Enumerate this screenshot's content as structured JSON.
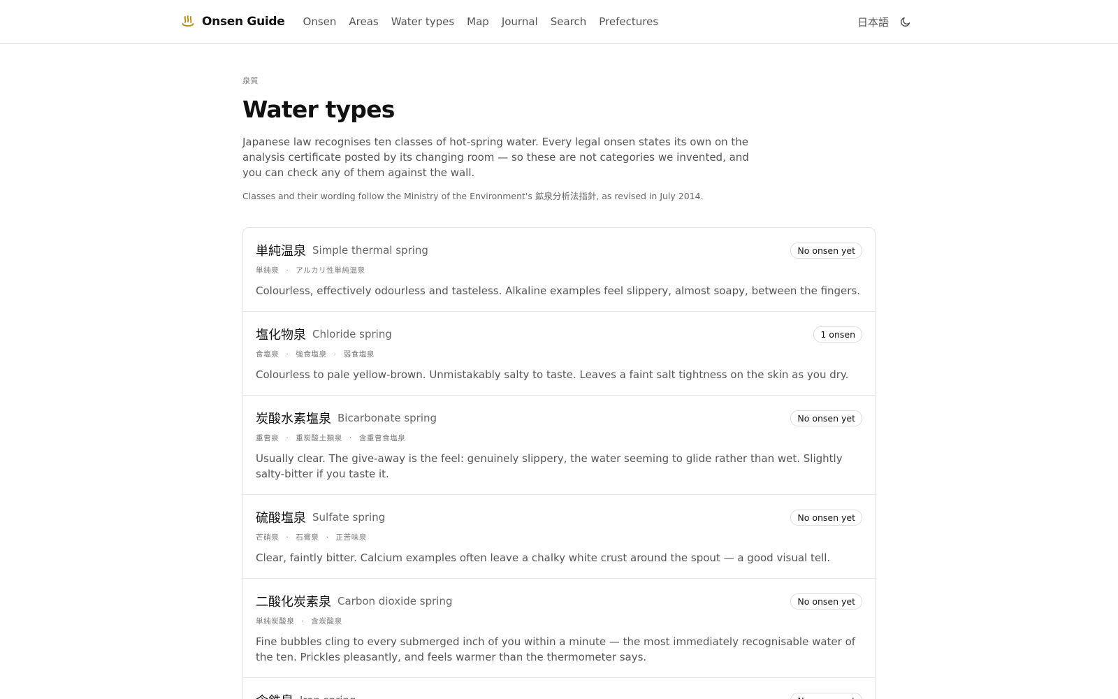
{
  "header": {
    "brand": "Onsen Guide",
    "nav": [
      "Onsen",
      "Areas",
      "Water types",
      "Map",
      "Journal",
      "Search",
      "Prefectures"
    ],
    "language": "日本語",
    "accent": "#b8860b"
  },
  "page": {
    "eyebrow": "泉質",
    "title": "Water types",
    "intro": "Japanese law recognises ten classes of hot-spring water. Every legal onsen states its own on the analysis certificate posted by its changing room — so these are not categories we invented, and you can check any of them against the wall.",
    "source_note": "Classes and their wording follow the Ministry of the Environment's 鉱泉分析法指針, as revised in July 2014."
  },
  "water_types": [
    {
      "ja": "単純温泉",
      "en": "Simple thermal spring",
      "aliases": [
        "単純泉",
        "アルカリ性単純温泉"
      ],
      "badge": "No onsen yet",
      "description": "Colourless, effectively odourless and tasteless. Alkaline examples feel slippery, almost soapy, between the fingers."
    },
    {
      "ja": "塩化物泉",
      "en": "Chloride spring",
      "aliases": [
        "食塩泉",
        "強食塩泉",
        "弱食塩泉"
      ],
      "badge": "1 onsen",
      "description": "Colourless to pale yellow-brown. Unmistakably salty to taste. Leaves a faint salt tightness on the skin as you dry."
    },
    {
      "ja": "炭酸水素塩泉",
      "en": "Bicarbonate spring",
      "aliases": [
        "重曹泉",
        "重炭酸土類泉",
        "含重曹食塩泉"
      ],
      "badge": "No onsen yet",
      "description": "Usually clear. The give-away is the feel: genuinely slippery, the water seeming to glide rather than wet. Slightly salty-bitter if you taste it."
    },
    {
      "ja": "硫酸塩泉",
      "en": "Sulfate spring",
      "aliases": [
        "芒硝泉",
        "石膏泉",
        "正苦味泉"
      ],
      "badge": "No onsen yet",
      "description": "Clear, faintly bitter. Calcium examples often leave a chalky white crust around the spout — a good visual tell."
    },
    {
      "ja": "二酸化炭素泉",
      "en": "Carbon dioxide spring",
      "aliases": [
        "単純炭酸泉",
        "含炭酸泉"
      ],
      "badge": "No onsen yet",
      "description": "Fine bubbles cling to every submerged inch of you within a minute — the most immediately recognisable water of the ten. Prickles pleasantly, and feels warmer than the thermometer says."
    },
    {
      "ja": "含鉄泉",
      "en": "Iron spring",
      "aliases": [],
      "badge": "No onsen yet",
      "description": ""
    }
  ]
}
